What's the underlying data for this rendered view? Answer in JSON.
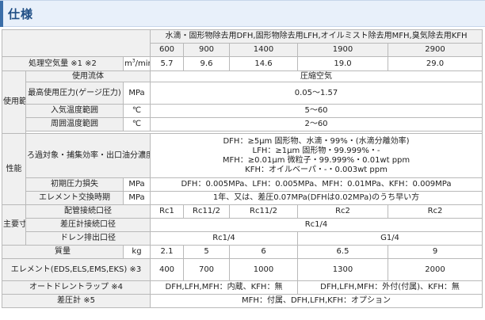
{
  "section_title": "仕様",
  "header": {
    "model_group": "水滴・固形物除去用DFH,固形物除去用LFH,オイルミスト除去用MFH,臭気除去用KFH",
    "models": [
      "600",
      "900",
      "1400",
      "1900",
      "2900"
    ]
  },
  "air_flow": {
    "label": "処理空気量 ※1 ※2",
    "unit_base": "m",
    "unit_sup": "3",
    "unit_tail": "/min",
    "values": [
      "5.7",
      "9.6",
      "14.6",
      "19.0",
      "29.0"
    ]
  },
  "usage": {
    "group_label": "使用範囲",
    "fluid": {
      "label": "使用流体",
      "value": "圧縮空気"
    },
    "pressure": {
      "label": "最高使用圧力(ゲージ圧力)",
      "unit": "MPa",
      "value": "0.05～1.57"
    },
    "inlet_temp": {
      "label": "入気温度範囲",
      "unit": "℃",
      "value": "5～60"
    },
    "ambient_temp": {
      "label": "周囲温度範囲",
      "unit": "℃",
      "value": "2～60"
    }
  },
  "performance": {
    "group_label": "性能",
    "filtration": {
      "label": "ろ過対象・捕集効率・出口油分濃度",
      "lines": [
        "DFH：≥5μm 固形物、水滴・99%・(水滴分離効率)",
        "LFH：≥1μm 固形物・99.999%・-",
        "MFH：≥0.01μm 微粒子・99.999%・0.01wt ppm",
        "KFH：オイルベーパ・-・0.003wt ppm"
      ]
    },
    "pressure_loss": {
      "label": "初期圧力損失",
      "unit": "MPa",
      "value": "DFH：0.005MPa、LFH：0.005MPa、MFH：0.01MPa、KFH：0.009MPa"
    },
    "element_replace": {
      "label": "エレメント交換時期",
      "unit": "MPa",
      "value": "1年、又は、差圧0.07MPa(DFHは0.02MPa)のうち早い方"
    }
  },
  "dimensions": {
    "group_label": "主要寸法",
    "piping": {
      "label": "配管接続口径",
      "values": [
        "Rc1",
        "Rc11/2",
        "Rc11/2",
        "Rc2",
        "Rc2"
      ]
    },
    "diff_gauge": {
      "label": "差圧計接続口径",
      "value": "Rc1/4"
    },
    "drain": {
      "label": "ドレン排出口径",
      "values": [
        "Rc1/4",
        "G1/4"
      ]
    }
  },
  "mass": {
    "label": "質量",
    "unit": "kg",
    "values": [
      "2.1",
      "5",
      "6",
      "6.5",
      "9"
    ]
  },
  "element": {
    "label": "エレメント(EDS,ELS,EMS,EKS) ※3",
    "values": [
      "400",
      "700",
      "1000",
      "1300",
      "2000"
    ]
  },
  "auto_drain": {
    "label": "オートドレントラップ ※4",
    "values": [
      "DFH,LFH,MFH：内蔵、KFH：無",
      "DFH,LFH,MFH：外付(付属)、KFH：無"
    ]
  },
  "diff_pressure_gauge": {
    "label": "差圧計 ※5",
    "value": "MFH：付属、DFH,LFH,KFH：オプション"
  }
}
